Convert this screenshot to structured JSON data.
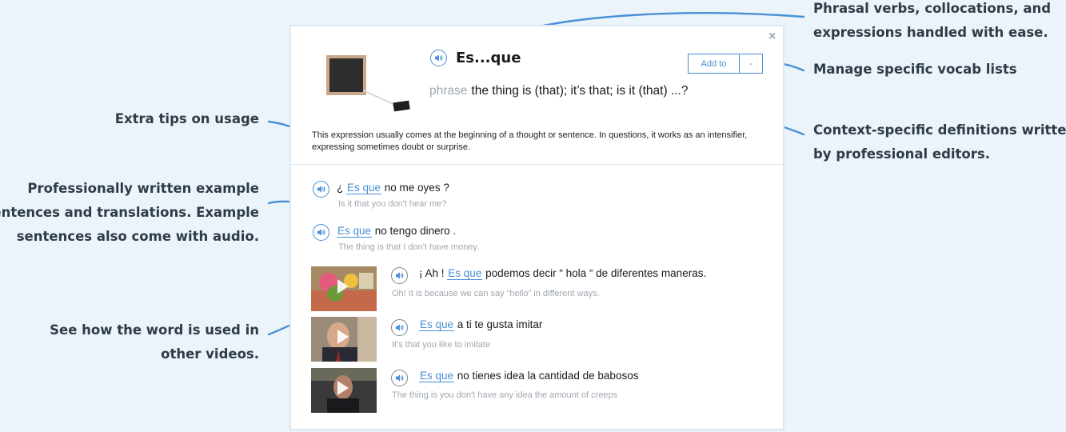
{
  "callouts": {
    "phrasal_1": "Phrasal verbs, collocations, and",
    "phrasal_2": "expressions handled with ease.",
    "vocab": "Manage specific vocab lists",
    "context_1": "Context-specific definitions written",
    "context_2": "by professional editors.",
    "tips": "Extra tips on usage",
    "examples_1": "Professionally written example",
    "examples_2": "sentences and translations. Example",
    "examples_3": "sentences also come with audio.",
    "videos_1": "See how the word is used in",
    "videos_2": "other videos."
  },
  "card": {
    "close": "×",
    "title": "Es...que",
    "add_to": "Add to",
    "dropdown": "-",
    "pos": "phrase",
    "definition": "the thing is (that); it’s that; is it (that) ...?",
    "tip": "This expression usually comes at the beginning of a thought or sentence. In questions, it works as an intensifier, expressing sometimes doubt or surprise."
  },
  "examples": [
    {
      "pre": "¿ ",
      "hl": "Es que",
      "post": " no me oyes ?",
      "tr": "Is it that you don't hear me?"
    },
    {
      "pre": "",
      "hl": "Es que",
      "post": " no tengo dinero .",
      "tr": "The thing is that I don't have money."
    }
  ],
  "videos": [
    {
      "pre": "¡ Ah ! ",
      "hl": "Es que",
      "post": " podemos decir “ hola “ de diferentes maneras.",
      "tr": "Oh! It is because we can say “hello” in different ways."
    },
    {
      "pre": "",
      "hl": "Es que",
      "post": " a ti te gusta imitar",
      "tr": "It's that you like to imitate"
    },
    {
      "pre": "",
      "hl": "Es que",
      "post": " no tienes idea la cantidad de babosos",
      "tr": "The thing is you don't have any idea the amount of creeps"
    }
  ],
  "colors": {
    "accent": "#4a8fd6",
    "background": "#ebf4fb",
    "callout_text": "#2f3b46"
  },
  "icons": [
    "speaker-icon",
    "close-icon",
    "play-icon",
    "arrow-icon"
  ]
}
